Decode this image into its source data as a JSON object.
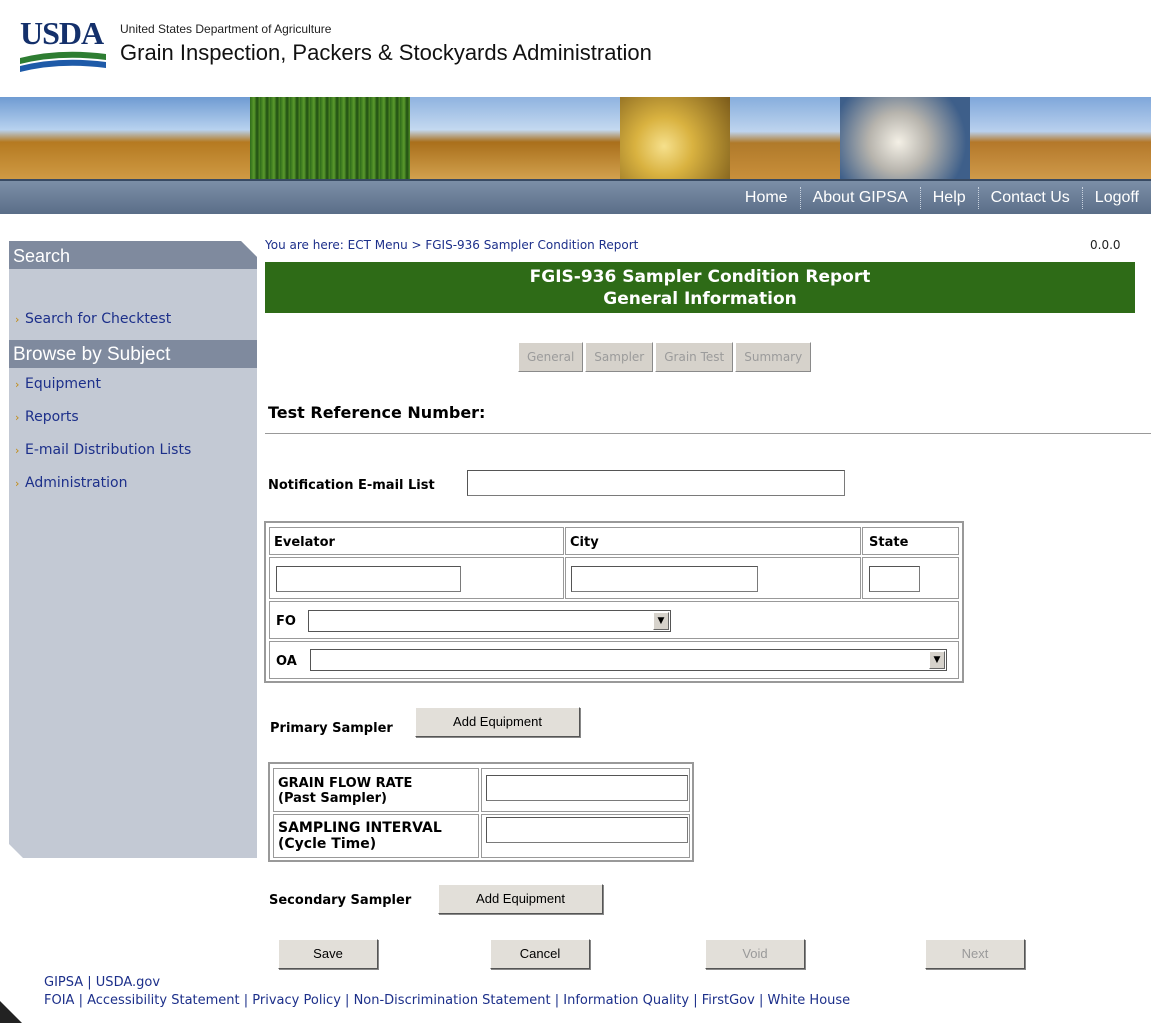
{
  "header": {
    "logo_text": "USDA",
    "department": "United States Department of Agriculture",
    "agency": "Grain Inspection, Packers & Stockyards Administration"
  },
  "nav": {
    "items": [
      "Home",
      "About GIPSA",
      "Help",
      "Contact Us",
      "Logoff"
    ]
  },
  "sidebar": {
    "search_heading": "Search",
    "search_link": "Search for Checktest",
    "browse_heading": "Browse by Subject",
    "items": [
      "Equipment",
      "Reports",
      "E-mail Distribution Lists",
      "Administration"
    ]
  },
  "main": {
    "breadcrumb": "You are here: ECT Menu > FGIS-936 Sampler Condition Report",
    "version": "0.0.0",
    "title_line1": "FGIS-936 Sampler Condition Report",
    "title_line2": "General Information",
    "tabs": [
      "General",
      "Sampler",
      "Grain Test",
      "Summary"
    ],
    "test_reference_label": "Test Reference Number:",
    "notification_label": "Notification E-mail List",
    "notification_value": "",
    "location": {
      "elevator_label": "Evelator",
      "city_label": "City",
      "state_label": "State",
      "elevator_value": "",
      "city_value": "",
      "state_value": "",
      "fo_label": "FO",
      "fo_value": "",
      "oa_label": "OA",
      "oa_value": ""
    },
    "primary_sampler_label": "Primary Sampler",
    "add_equipment_label": "Add Equipment",
    "grain_flow_label_1": "GRAIN FLOW RATE",
    "grain_flow_label_2": "(Past Sampler)",
    "grain_flow_value": "",
    "sampling_interval_label_1": "SAMPLING INTERVAL",
    "sampling_interval_label_2": "(Cycle Time)",
    "sampling_interval_value": "",
    "secondary_sampler_label": "Secondary Sampler",
    "buttons": {
      "save": "Save",
      "cancel": "Cancel",
      "void": "Void",
      "next": "Next"
    }
  },
  "footer": {
    "line1": [
      "GIPSA",
      "USDA.gov"
    ],
    "line2": [
      "FOIA",
      "Accessibility Statement",
      "Privacy Policy",
      "Non-Discrimination Statement",
      "Information Quality",
      "FirstGov",
      "White House"
    ]
  },
  "colors": {
    "title_bar": "#2e6b17",
    "nav_bar": "#6a7d96",
    "sidebar_bg": "#c3c9d4",
    "sidebar_heading": "#7f8a9e",
    "link": "#1c2f8a"
  }
}
